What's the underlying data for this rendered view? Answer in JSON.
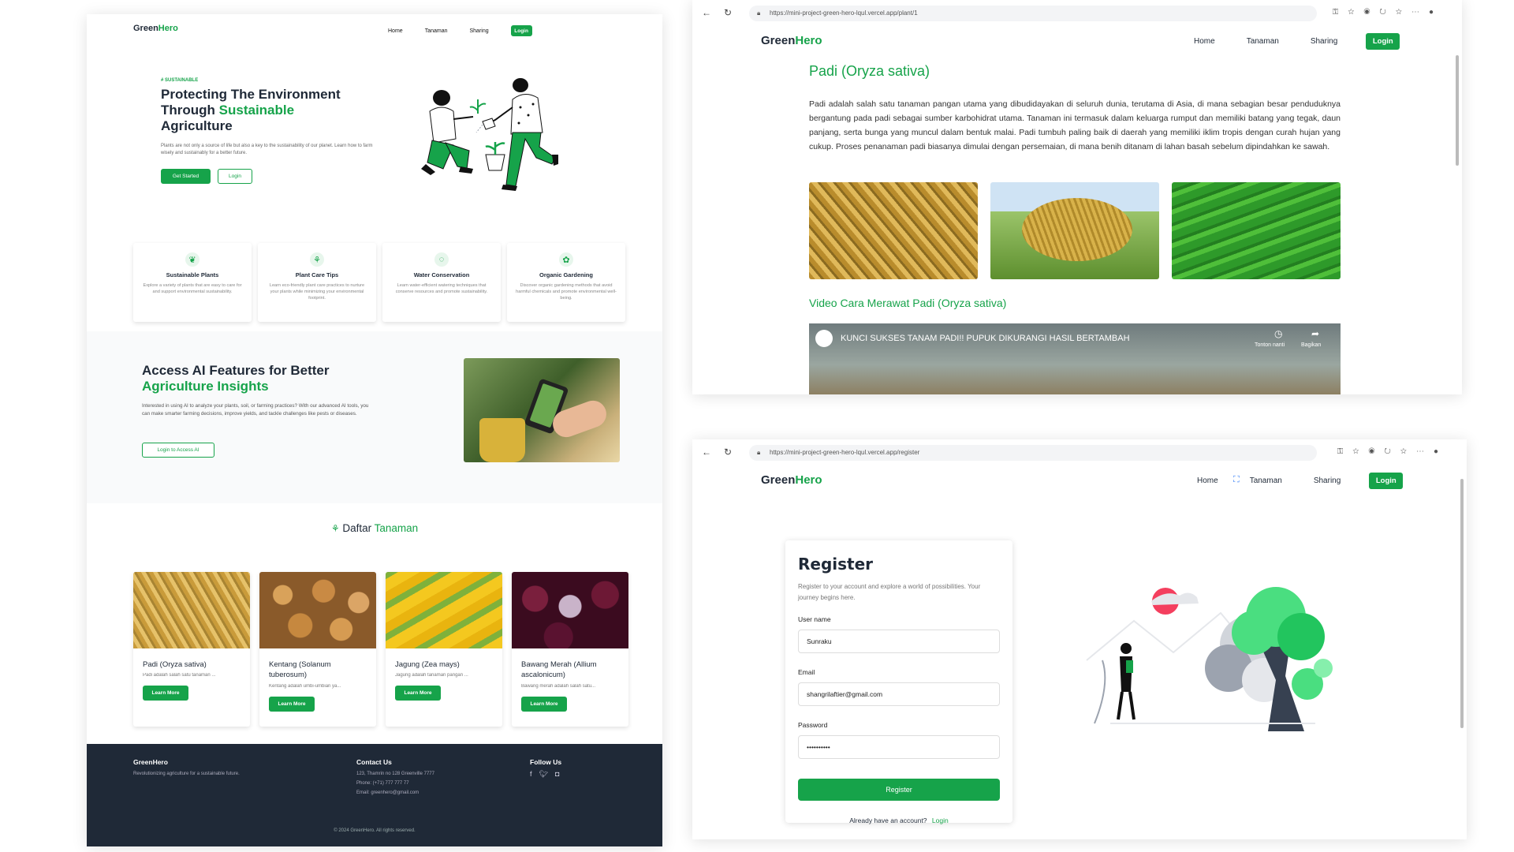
{
  "brand": {
    "green": "Green",
    "hero": "Hero"
  },
  "nav": {
    "home": "Home",
    "tanaman": "Tanaman",
    "sharing": "Sharing",
    "login": "Login"
  },
  "hero": {
    "eyebrow": "# SUSTAINABLE",
    "title_1": "Protecting The Environment",
    "title_2a": "Through ",
    "title_2b": "Sustainable",
    "title_3": "Agriculture",
    "desc": "Plants are not only a source of life but also a key to the sustainability of our planet. Learn how to farm wisely and sustainably for a better future.",
    "get_started": "Get Started",
    "login": "Login"
  },
  "features": [
    {
      "icon": "leaf-icon",
      "title": "Sustainable Plants",
      "desc": "Explore a variety of plants that are easy to care for and support environmental sustainability."
    },
    {
      "icon": "sprout-icon",
      "title": "Plant Care Tips",
      "desc": "Learn eco-friendly plant care practices to nurture your plants while minimizing your environmental footprint."
    },
    {
      "icon": "water-icon",
      "title": "Water Conservation",
      "desc": "Learn water-efficient watering techniques that conserve resources and promote sustainability."
    },
    {
      "icon": "flower-icon",
      "title": "Organic Gardening",
      "desc": "Discover organic gardening methods that avoid harmful chemicals and promote environmental well-being."
    }
  ],
  "ai": {
    "title_1": "Access AI Features for Better",
    "title_2": "Agriculture Insights",
    "desc": "Interested in using AI to analyze your plants, soil, or farming practices? With our advanced AI tools, you can make smarter farming decisions, improve yields, and tackle challenges like pests or diseases.",
    "button": "Login to Access AI"
  },
  "daftar": {
    "a": "Daftar ",
    "b": "Tanaman"
  },
  "plants": [
    {
      "name": "Padi (Oryza sativa)",
      "desc": "Padi adalah salah satu tanaman ...",
      "button": "Learn More"
    },
    {
      "name": "Kentang (Solanum tuberosum)",
      "desc": "Kentang adalah umbi-umbian ya...",
      "button": "Learn More"
    },
    {
      "name": "Jagung (Zea mays)",
      "desc": "Jagung adalah tanaman pangan ...",
      "button": "Learn More"
    },
    {
      "name": "Bawang Merah (Allium ascalonicum)",
      "desc": "Bawang merah adalah salah satu...",
      "button": "Learn More"
    }
  ],
  "footer": {
    "brand": "GreenHero",
    "tagline": "Revolutionizing agriculture for a sustainable future.",
    "contact_title": "Contact Us",
    "address": "123, Thamrin no 128 Greenville 7777",
    "phone": "Phone: (+71) 777 777 77",
    "email": "Email: greenhero@gmail.com",
    "follow": "Follow Us",
    "copyright": "© 2024 GreenHero. All rights reserved."
  },
  "browser1": {
    "url": "https://mini-project-green-hero-lqul.vercel.app/plant/1"
  },
  "detail": {
    "title": "Padi (Oryza sativa)",
    "body": "Padi adalah salah satu tanaman pangan utama yang dibudidayakan di seluruh dunia, terutama di Asia, di mana sebagian besar penduduknya bergantung pada padi sebagai sumber karbohidrat utama. Tanaman ini termasuk dalam keluarga rumput dan memiliki batang yang tegak, daun panjang, serta bunga yang muncul dalam bentuk malai. Padi tumbuh paling baik di daerah yang memiliki iklim tropis dengan curah hujan yang cukup. Proses penanaman padi biasanya dimulai dengan persemaian, di mana benih ditanam di lahan basah sebelum dipindahkan ke sawah.",
    "video_title": "Video Cara Merawat Padi (Oryza sativa)",
    "video_caption": "KUNCI SUKSES TANAM PADI!! PUPUK DIKURANGI HASIL BERTAMBAH",
    "watch_later": "Tonton nanti",
    "share": "Bagikan"
  },
  "browser2": {
    "url": "https://mini-project-green-hero-lqul.vercel.app/register"
  },
  "register": {
    "title": "Register",
    "subtitle": "Register to your account and explore a world of possibilities. Your journey begins here.",
    "username_label": "User name",
    "username_value": "Sunraku",
    "email_label": "Email",
    "email_value": "shangrilaftier@gmail.com",
    "password_label": "Password",
    "password_value": "••••••••••",
    "button": "Register",
    "have_account": "Already have an account?",
    "login_link": "Login"
  }
}
